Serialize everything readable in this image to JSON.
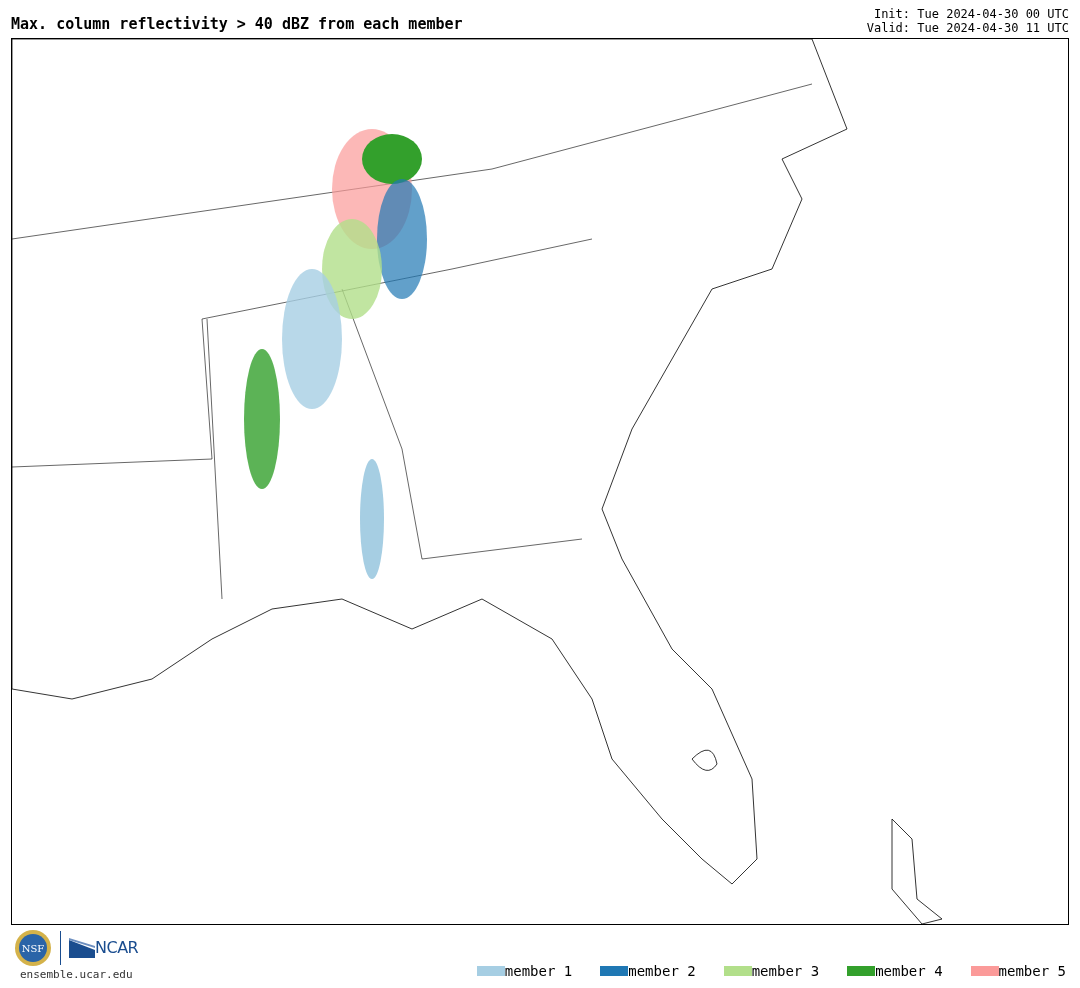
{
  "title": "Max. column reflectivity > 40 dBZ from each member",
  "init": "Init: Tue 2024-04-30 00 UTC",
  "valid": "Valid: Tue 2024-04-30 11 UTC",
  "logos": {
    "nsf": "NSF",
    "ncar": "NCAR",
    "site": "ensemble.ucar.edu"
  },
  "legend": [
    {
      "label": "member 1",
      "color": "#a6cee3"
    },
    {
      "label": "member 2",
      "color": "#1f78b4"
    },
    {
      "label": "member 3",
      "color": "#b2df8a"
    },
    {
      "label": "member 4",
      "color": "#33a02c"
    },
    {
      "label": "member 5",
      "color": "#fb9a99"
    }
  ]
}
